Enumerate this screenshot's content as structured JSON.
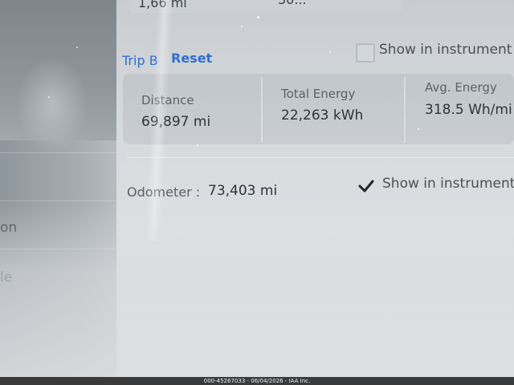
{
  "previous_row": {
    "value_left": "1,66 mi",
    "value_right": "30..."
  },
  "trip": {
    "label": "Trip B",
    "reset_label": "Reset",
    "show_in_instrument_label": "Show in instrument p",
    "show_in_instrument_checked": false,
    "stats": [
      {
        "label": "Distance",
        "value": "69,897 mi"
      },
      {
        "label": "Total Energy",
        "value": "22,263 kWh"
      },
      {
        "label": "Avg. Energy",
        "value": "318.5 Wh/mi"
      }
    ]
  },
  "odometer": {
    "label": "Odometer :",
    "value": "73,403 mi",
    "show_in_instrument_label": "Show in instrument",
    "show_in_instrument_checked": true
  },
  "sidebar": {
    "items": [
      {
        "label": "on"
      },
      {
        "label": "le"
      }
    ]
  },
  "caption": "000-45267033 - 06/04/2026 - IAA Inc.",
  "colors": {
    "link": "#2f6fd1",
    "text_primary": "#2d3338",
    "text_secondary": "#5b6166"
  }
}
